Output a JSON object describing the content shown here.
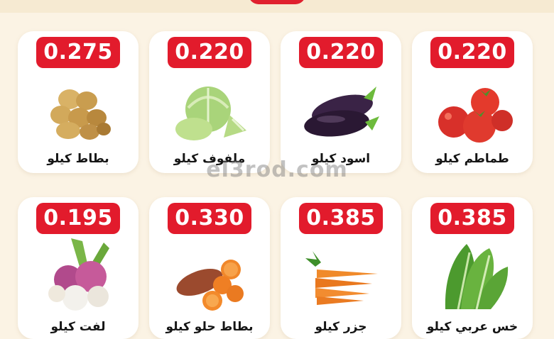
{
  "products": [
    {
      "price": "0.275",
      "label": "بطاط كيلو",
      "icon": "potato-icon"
    },
    {
      "price": "0.220",
      "label": "ملفوف كيلو",
      "icon": "cabbage-icon"
    },
    {
      "price": "0.220",
      "label": "اسود كيلو",
      "icon": "eggplant-icon"
    },
    {
      "price": "0.220",
      "label": "طماطم كيلو",
      "icon": "tomato-icon"
    },
    {
      "price": "0.195",
      "label": "لفت كيلو",
      "icon": "turnip-icon"
    },
    {
      "price": "0.330",
      "label": "بطاط حلو كيلو",
      "icon": "sweet-potato-icon"
    },
    {
      "price": "0.385",
      "label": "جزر كيلو",
      "icon": "carrot-icon"
    },
    {
      "price": "0.385",
      "label": "خس عربي كيلو",
      "icon": "lettuce-icon"
    }
  ],
  "watermark": "el3rod.com",
  "colors": {
    "badge": "#e21b2c",
    "background": "#fbf3e4",
    "card": "#ffffff"
  }
}
